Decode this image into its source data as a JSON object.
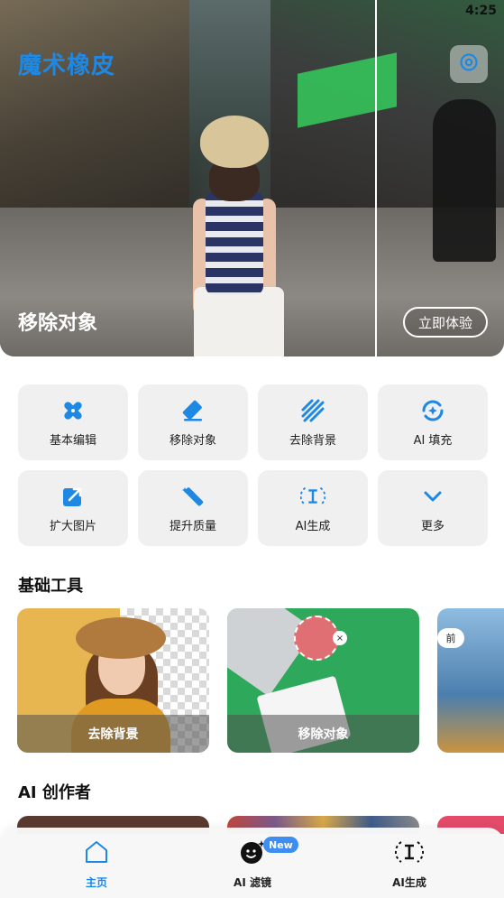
{
  "status": {
    "time": "4:25"
  },
  "header": {
    "app_title": "魔术橡皮"
  },
  "hero": {
    "label": "移除对象",
    "cta": "立即体验"
  },
  "tools": [
    {
      "label": "基本编辑",
      "icon": "bandage-icon"
    },
    {
      "label": "移除对象",
      "icon": "eraser-icon"
    },
    {
      "label": "去除背景",
      "icon": "stripes-icon"
    },
    {
      "label": "AI 填充",
      "icon": "ai-fill-icon"
    },
    {
      "label": "扩大图片",
      "icon": "expand-image-icon"
    },
    {
      "label": "提升质量",
      "icon": "magic-wand-icon"
    },
    {
      "label": "AI生成",
      "icon": "ai-generate-icon"
    },
    {
      "label": "更多",
      "icon": "chevron-down-icon"
    }
  ],
  "basic_tools": {
    "title": "基础工具",
    "cards": [
      {
        "caption": "去除背景"
      },
      {
        "caption": "移除对象"
      },
      {
        "tag": "前"
      }
    ]
  },
  "ai_creators": {
    "title": "AI 创作者"
  },
  "bottom_nav": {
    "items": [
      {
        "label": "主页",
        "active": true
      },
      {
        "label": "AI 滤镜",
        "badge": "New"
      },
      {
        "label": "AI生成"
      }
    ]
  },
  "colors": {
    "accent": "#1e88e5",
    "badge": "#3d8ef0",
    "tile": "#f0f0f0"
  }
}
